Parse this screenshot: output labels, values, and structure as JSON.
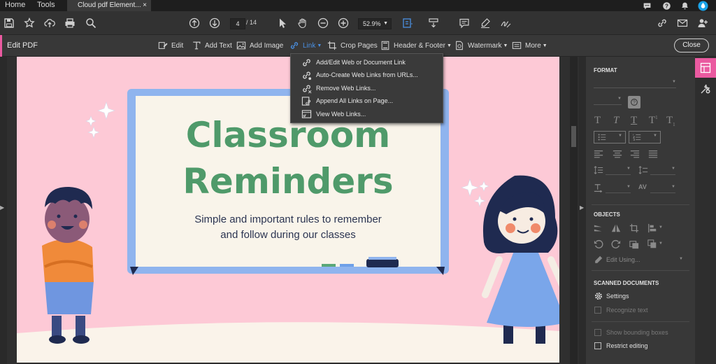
{
  "tabs": {
    "home": "Home",
    "tools": "Tools",
    "document": "Cloud pdf Element...",
    "close_glyph": "×"
  },
  "toolbar": {
    "page_current": "4",
    "page_total": "/ 14",
    "zoom": "52.9%"
  },
  "edit_bar": {
    "title": "Edit PDF",
    "tools": [
      "Edit",
      "Add Text",
      "Add Image",
      "Link",
      "Crop Pages",
      "Header & Footer",
      "Watermark",
      "More"
    ],
    "close": "Close"
  },
  "link_menu": {
    "items": [
      "Add/Edit Web or Document Link",
      "Auto-Create Web Links from URLs...",
      "Remove Web Links...",
      "Append All Links on Page...",
      "View Web Links..."
    ]
  },
  "slide": {
    "title_line1": "Classroom",
    "title_line2": "Reminders",
    "subtitle_line1": "Simple and important rules to remember",
    "subtitle_line2": "and follow during our classes"
  },
  "panel": {
    "format_header": "FORMAT",
    "objects_header": "OBJECTS",
    "edit_using": "Edit Using...",
    "scanned_header": "SCANNED DOCUMENTS",
    "settings": "Settings",
    "recognize_text": "Recognize text",
    "show_bounding": "Show bounding boxes",
    "restrict_editing": "Restrict editing"
  },
  "colors": {
    "accent": "#ea5aa0",
    "link_blue": "#4a90e2",
    "slide_bg": "#fdc9d6",
    "title_green": "#4f9a6a",
    "board_frame": "#8fb4ee"
  }
}
